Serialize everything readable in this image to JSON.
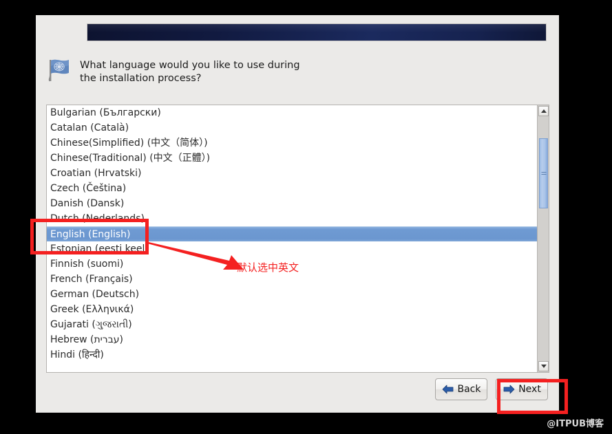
{
  "window": {
    "background_color": "#ebeae8",
    "banner_color": "#16224f"
  },
  "prompt": {
    "icon": "flag-icon",
    "text": "What language would you like to use during the installation process?"
  },
  "language_list": {
    "selected": "English (English)",
    "items": [
      {
        "label": "Bulgarian (Български)",
        "selected": false
      },
      {
        "label": "Catalan (Català)",
        "selected": false
      },
      {
        "label": "Chinese(Simplified) (中文（简体）)",
        "selected": false
      },
      {
        "label": "Chinese(Traditional) (中文（正體）)",
        "selected": false
      },
      {
        "label": "Croatian (Hrvatski)",
        "selected": false
      },
      {
        "label": "Czech (Čeština)",
        "selected": false
      },
      {
        "label": "Danish (Dansk)",
        "selected": false
      },
      {
        "label": "Dutch (Nederlands)",
        "selected": false
      },
      {
        "label": "English (English)",
        "selected": true
      },
      {
        "label": "Estonian (eesti keel)",
        "selected": false
      },
      {
        "label": "Finnish (suomi)",
        "selected": false
      },
      {
        "label": "French (Français)",
        "selected": false
      },
      {
        "label": "German (Deutsch)",
        "selected": false
      },
      {
        "label": "Greek (Ελληνικά)",
        "selected": false
      },
      {
        "label": "Gujarati (ગુજરાતી)",
        "selected": false
      },
      {
        "label": "Hebrew (עברית)",
        "selected": false
      },
      {
        "label": "Hindi (हिन्दी)",
        "selected": false
      }
    ]
  },
  "scrollbar": {
    "up_arrow": "chevron-up-icon",
    "down_arrow": "chevron-down-icon"
  },
  "buttons": {
    "back": "Back",
    "next": "Next"
  },
  "annotations": {
    "highlight_color": "#f42020",
    "note_text": "默认选中英文",
    "boxes": [
      "english-row",
      "next-button"
    ]
  },
  "watermark": {
    "text": "@ITPUB博客"
  }
}
